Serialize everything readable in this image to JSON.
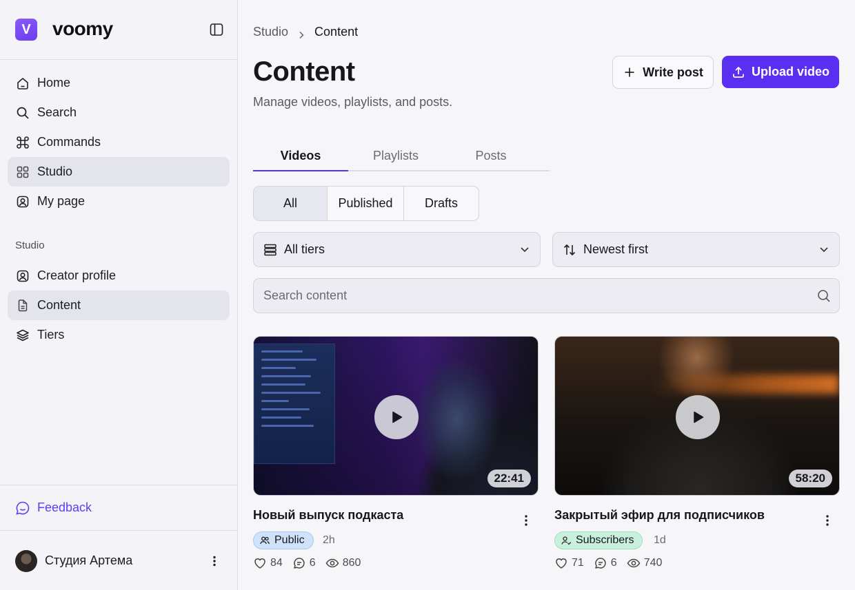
{
  "brand": {
    "logo_letter": "V",
    "name": "voomy",
    "accent": "#5a2ff2"
  },
  "sidebar": {
    "items": [
      {
        "label": "Home",
        "icon": "home-icon"
      },
      {
        "label": "Search",
        "icon": "search-icon"
      },
      {
        "label": "Commands",
        "icon": "command-icon"
      },
      {
        "label": "Studio",
        "icon": "grid-icon",
        "active": true
      },
      {
        "label": "My page",
        "icon": "user-square-icon"
      }
    ],
    "section_label": "Studio",
    "studio_items": [
      {
        "label": "Creator profile",
        "icon": "user-square-icon"
      },
      {
        "label": "Content",
        "icon": "file-icon",
        "active": true
      },
      {
        "label": "Tiers",
        "icon": "layers-icon"
      }
    ],
    "feedback_label": "Feedback",
    "user_name": "Студия Артема"
  },
  "breadcrumb": {
    "root": "Studio",
    "current": "Content"
  },
  "page": {
    "title": "Content",
    "subtitle": "Manage videos, playlists, and posts.",
    "write_post_label": "Write post",
    "upload_video_label": "Upload video"
  },
  "tabs": [
    {
      "label": "Videos",
      "active": true
    },
    {
      "label": "Playlists"
    },
    {
      "label": "Posts"
    }
  ],
  "filters": {
    "status": [
      "All",
      "Published",
      "Drafts"
    ],
    "status_selected": "All",
    "tier_select": "All tiers",
    "sort_select": "Newest first",
    "search_placeholder": "Search content"
  },
  "videos": [
    {
      "title": "Новый выпуск подкаста",
      "duration": "22:41",
      "visibility": "Public",
      "age": "2h",
      "likes": "84",
      "comments": "6",
      "views": "860"
    },
    {
      "title": "Закрытый эфир для подписчиков",
      "duration": "58:20",
      "visibility": "Subscribers",
      "age": "1d",
      "likes": "71",
      "comments": "6",
      "views": "740"
    }
  ]
}
